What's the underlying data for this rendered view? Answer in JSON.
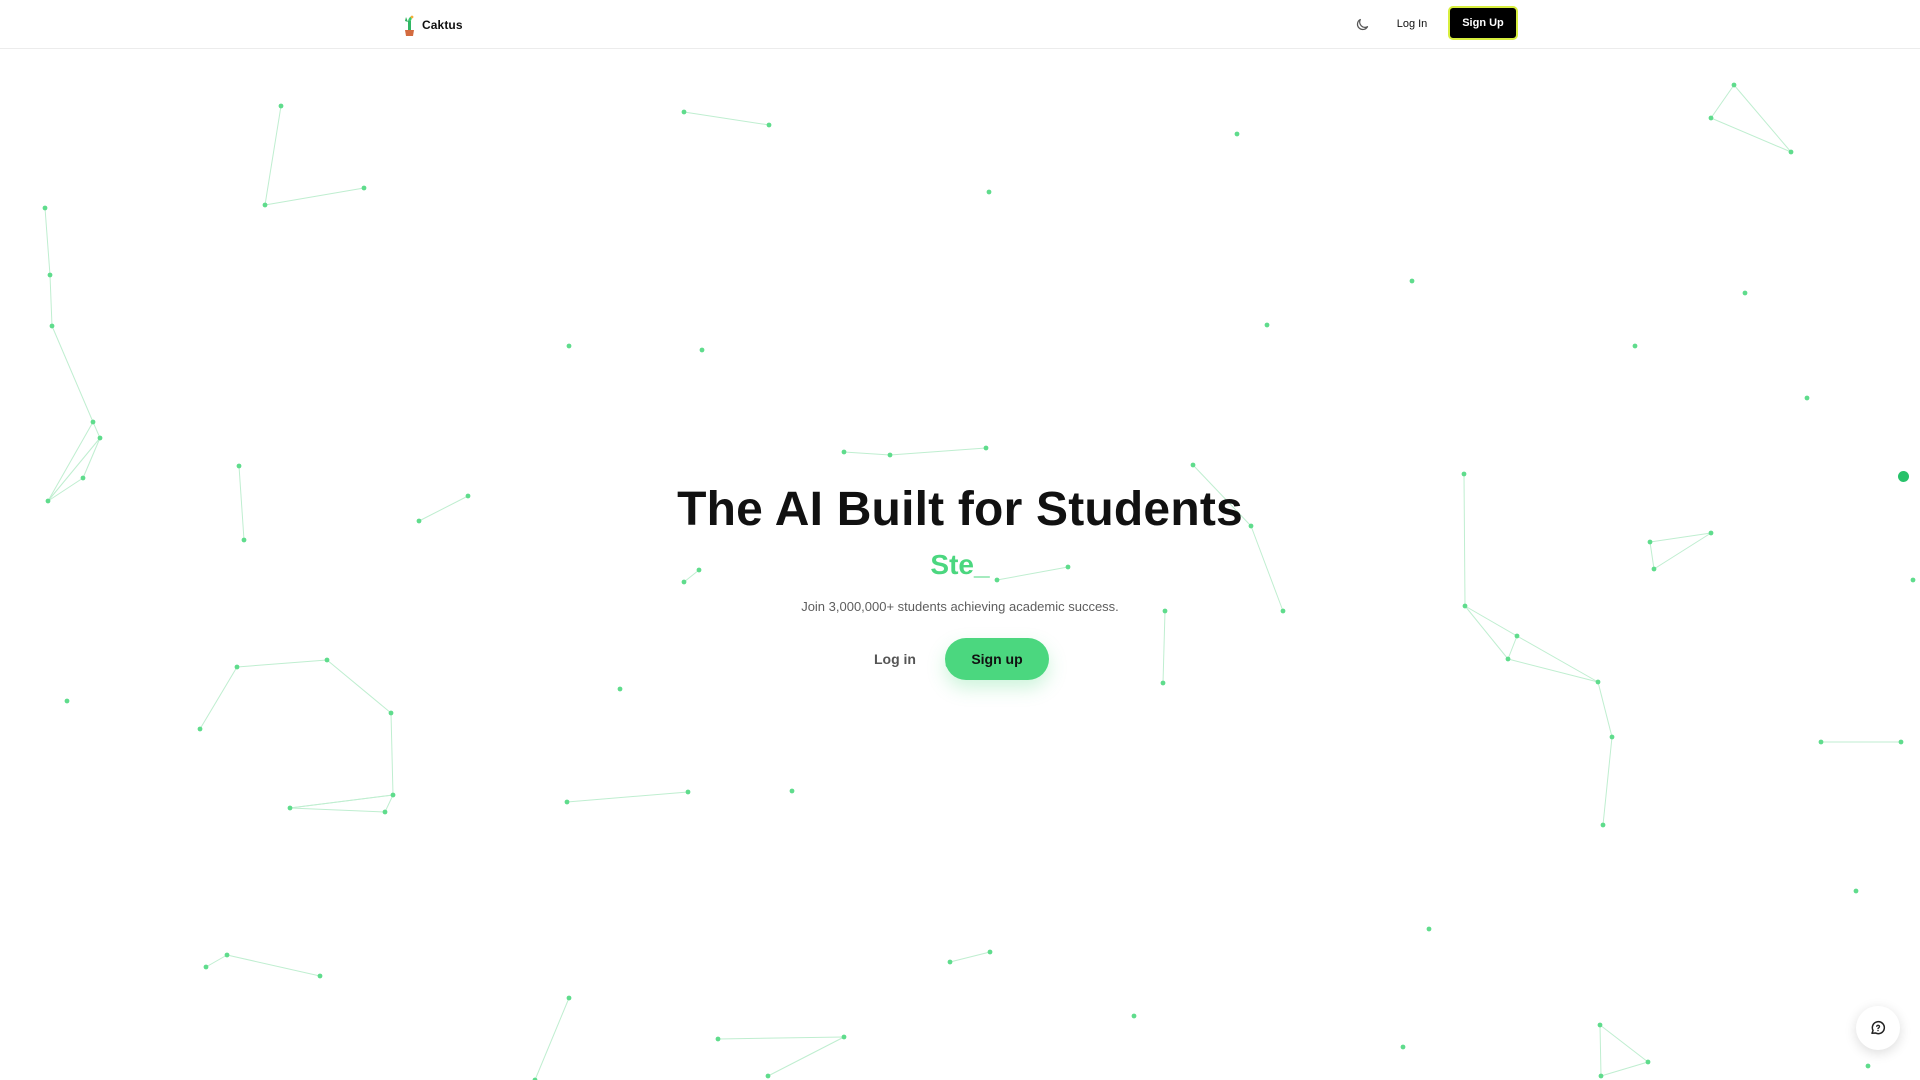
{
  "header": {
    "brand_name": "Caktus",
    "nav_login_label": "Log In",
    "nav_signup_label": "Sign Up",
    "icons": {
      "logo": "cactus-logo",
      "theme_toggle": "moon-icon"
    }
  },
  "hero": {
    "title": "The AI Built for Students",
    "typewriter_text": "Ste_",
    "subtitle": "Join 3,000,000+ students achieving academic success.",
    "login_label": "Log in",
    "signup_label": "Sign up"
  },
  "widgets": {
    "chat_icon": "chat-help-icon"
  },
  "colors": {
    "accent": "#4bd77f",
    "network_line": "#bfeed0",
    "network_node": "#5fdc8c",
    "nav_button_bg": "#000000",
    "nav_button_border": "#d8ef3f",
    "status_dot": "#27c26a"
  }
}
